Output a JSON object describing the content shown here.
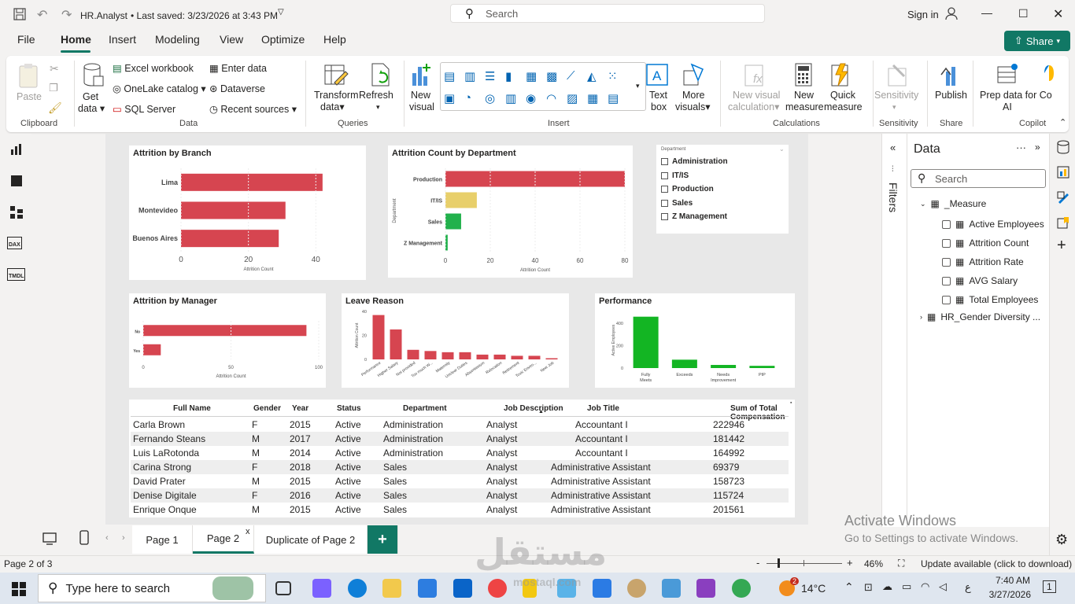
{
  "titlebar": {
    "filename": "HR.Analyst",
    "saved": "•  Last saved: 3/23/2026 at 3:43 PM",
    "search": "Search",
    "signin": "Sign in"
  },
  "menu": {
    "file": "File",
    "home": "Home",
    "insert": "Insert",
    "modeling": "Modeling",
    "view": "View",
    "optimize": "Optimize",
    "help": "Help",
    "share": "Share"
  },
  "ribbon": {
    "paste": "Paste",
    "clipboard": "Clipboard",
    "get_data_1": "Get",
    "get_data_2": "data",
    "excel": "Excel workbook",
    "onelake": "OneLake catalog",
    "sql": "SQL Server",
    "enter_data": "Enter data",
    "dataverse": "Dataverse",
    "recent": "Recent sources",
    "data_group": "Data",
    "transform_1": "Transform",
    "transform_2": "data",
    "refresh": "Refresh",
    "queries": "Queries",
    "new_visual_1": "New",
    "new_visual_2": "visual",
    "insert_group": "Insert",
    "text_box_1": "Text",
    "text_box_2": "box",
    "more_visuals_1": "More",
    "more_visuals_2": "visuals",
    "new_calc_1": "New visual",
    "new_calc_2": "calculation",
    "new_measure_1": "New",
    "new_measure_2": "measure",
    "quick_measure_1": "Quick",
    "quick_measure_2": "measure",
    "calculations": "Calculations",
    "sensitivity": "Sensitivity",
    "sensitivity_group": "Sensitivity",
    "publish": "Publish",
    "share_group": "Share",
    "prep_1": "Prep data for Co",
    "prep_2": "AI",
    "copilot": "Copilot"
  },
  "visuals": {
    "branch": {
      "title": "Attrition by Branch"
    },
    "dept": {
      "title": "Attrition Count by Department"
    },
    "slicer": {
      "title": "Department",
      "items": [
        "Administration",
        "IT/IS",
        "Production",
        "Sales",
        "Z Management"
      ]
    },
    "manager": {
      "title": "Attrition by Manager"
    },
    "leave": {
      "title": "Leave Reason"
    },
    "performance": {
      "title": "Performance"
    }
  },
  "chart_data": [
    {
      "type": "bar",
      "orientation": "horizontal",
      "title": "Attrition by Branch",
      "categories": [
        "Lima",
        "Montevideo",
        "Buenos Aires"
      ],
      "values": [
        42,
        31,
        29
      ],
      "xlabel": "Attrition Count",
      "xticks": [
        "0",
        "20",
        "40"
      ],
      "xlim": [
        0,
        46
      ],
      "color": "#d64550"
    },
    {
      "type": "bar",
      "orientation": "horizontal",
      "title": "Attrition Count by Department",
      "categories": [
        "Production",
        "IT/IS",
        "Sales",
        "Z Management"
      ],
      "values": [
        80,
        14,
        7,
        1
      ],
      "colors": [
        "#d64550",
        "#e8cf6a",
        "#22b14c",
        "#22b14c"
      ],
      "xlabel": "Attrition Count",
      "ylabel": "Department",
      "xticks": [
        "0",
        "20",
        "40",
        "60",
        "80"
      ],
      "xlim": [
        0,
        80
      ]
    },
    {
      "type": "bar",
      "orientation": "horizontal",
      "title": "Attrition by Manager",
      "categories": [
        "No",
        "Yes"
      ],
      "values": [
        93,
        10
      ],
      "xlabel": "Attrition Count",
      "xticks": [
        "0",
        "50",
        "100"
      ],
      "xlim": [
        0,
        100
      ],
      "color": "#d64550"
    },
    {
      "type": "bar",
      "title": "Leave Reason",
      "categories": [
        "Performance",
        "Higher Salary",
        "Not provided",
        "Too much W...",
        "Maternity",
        "Unclear Duties",
        "Absenteeism",
        "Relocation",
        "Retirement",
        "Toxic Enviro...",
        "New Job"
      ],
      "values": [
        37,
        25,
        8,
        7,
        6,
        6,
        4,
        4,
        3,
        3,
        1
      ],
      "ylabel": "Attrition Count",
      "yticks": [
        "0",
        "20",
        "40"
      ],
      "ylim": [
        0,
        40
      ],
      "color": "#d64550"
    },
    {
      "type": "bar",
      "title": "Performance",
      "categories": [
        "Fully Meets",
        "Exceeds",
        "Needs Improvement",
        "PIP"
      ],
      "values": [
        460,
        75,
        28,
        20
      ],
      "ylabel": "Active Employees",
      "yticks": [
        "0",
        "200",
        "400"
      ],
      "ylim": [
        0,
        500
      ],
      "color": "#13b523"
    }
  ],
  "table": {
    "headers": [
      "Full Name",
      "Gender",
      "Year",
      "Status",
      "Department",
      "Job Description",
      "Job Title",
      "Sum of Total Compensation"
    ],
    "rows": [
      [
        "Carla Brown",
        "F",
        "2015",
        "Active",
        "Administration",
        "Analyst",
        "Accountant I",
        "222946"
      ],
      [
        "Fernando Steans",
        "M",
        "2017",
        "Active",
        "Administration",
        "Analyst",
        "Accountant I",
        "181442"
      ],
      [
        "Luis LaRotonda",
        "M",
        "2014",
        "Active",
        "Administration",
        "Analyst",
        "Accountant I",
        "164992"
      ],
      [
        "Carina Strong",
        "F",
        "2018",
        "Active",
        "Sales",
        "Analyst",
        "Administrative Assistant",
        "69379"
      ],
      [
        "David Prater",
        "M",
        "2015",
        "Active",
        "Sales",
        "Analyst",
        "Administrative Assistant",
        "158723"
      ],
      [
        "Denise Digitale",
        "F",
        "2016",
        "Active",
        "Sales",
        "Analyst",
        "Administrative Assistant",
        "115724"
      ],
      [
        "Enrique Onque",
        "M",
        "2015",
        "Active",
        "Sales",
        "Analyst",
        "Administrative Assistant",
        "201561"
      ]
    ]
  },
  "filters_label": "Filters",
  "datapane": {
    "title": "Data",
    "search": "Search",
    "measure_table": "_Measure",
    "measures": [
      "Active Employees",
      "Attrition Count",
      "Attrition Rate",
      "AVG Salary",
      "Total Employees"
    ],
    "other_table": "HR_Gender Diversity ..."
  },
  "pages": {
    "p1": "Page 1",
    "p2": "Page 2",
    "p3": "Duplicate of Page 2",
    "close": "x",
    "add": "+"
  },
  "status": {
    "page": "Page 2 of 3",
    "zoom": "46%",
    "update": "Update available (click to download)"
  },
  "activate": {
    "line1": "Activate Windows",
    "line2": "Go to Settings to activate Windows."
  },
  "taskbar": {
    "search": "Type here to search",
    "temp": "14°C",
    "time": "7:40 AM",
    "date": "3/27/2026",
    "lang": "ع",
    "badge": "2",
    "notif": "1"
  },
  "leftnav": {
    "dax": "DAX",
    "tmdl": "TMDL"
  },
  "watermark": {
    "brand": "mostaql.com"
  }
}
